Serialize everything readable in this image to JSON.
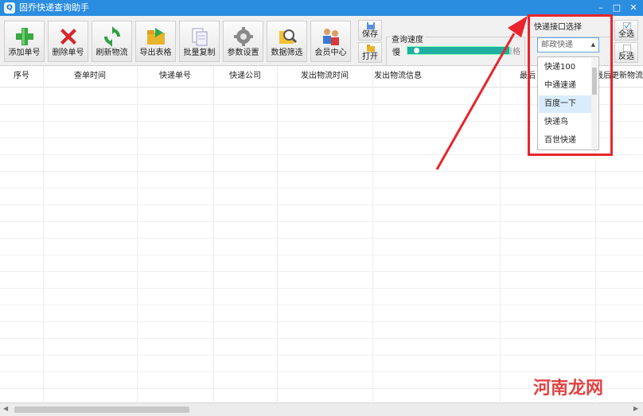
{
  "window": {
    "title": "固乔快递查询助手",
    "minimize": "–",
    "maximize": "□",
    "close": "✕"
  },
  "toolbar": {
    "buttons": [
      {
        "label": "添加单号",
        "icon": "add-icon"
      },
      {
        "label": "删除单号",
        "icon": "delete-icon"
      },
      {
        "label": "刷新物流",
        "icon": "refresh-icon"
      },
      {
        "label": "导出表格",
        "icon": "export-folder-icon"
      },
      {
        "label": "批量复制",
        "icon": "copy-icon"
      },
      {
        "label": "参数设置",
        "icon": "gear-icon"
      },
      {
        "label": "数据筛选",
        "icon": "search-filter-icon"
      },
      {
        "label": "会员中心",
        "icon": "members-icon"
      }
    ],
    "save_label": "保存",
    "open_label": "打开"
  },
  "speed": {
    "group_label": "查询速度",
    "scroll_table_label": "查询时滚动表格",
    "slow_label": "慢",
    "slider_value": 0.05
  },
  "api": {
    "group_label": "快递接口选择",
    "selected": "邮政快递",
    "options": [
      "快递100",
      "中通速递",
      "百度一下",
      "快递鸟",
      "百世快递"
    ],
    "highlighted_index": 2,
    "select_all": "全选",
    "invert_select": "反选"
  },
  "table": {
    "columns": [
      "序号",
      "查单时间",
      "快递单号",
      "快递公司",
      "发出物流时间",
      "发出物流信息",
      "最后",
      "最后更新物流"
    ]
  },
  "watermark": "河南龙网",
  "colors": {
    "titlebar": "#2a8de0",
    "annotation": "#e8252d",
    "slider": "#1fae9f"
  }
}
